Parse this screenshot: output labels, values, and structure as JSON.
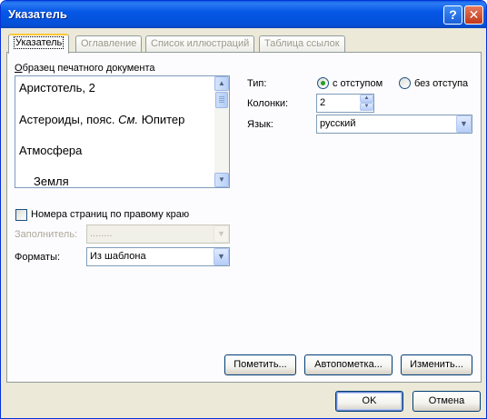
{
  "window": {
    "title": "Указатель",
    "help_button": "?",
    "close_button": "✕"
  },
  "tabs": [
    {
      "label": "Указатель",
      "active": true
    },
    {
      "label": "Оглавление",
      "active": false
    },
    {
      "label": "Список иллюстраций",
      "active": false
    },
    {
      "label": "Таблица ссылок",
      "active": false
    }
  ],
  "preview": {
    "label": "Образец печатного документа",
    "entries": [
      "Аристотель, 2",
      "Астероиды, пояс. См. Юпитер",
      "Атмосфера",
      "Земля"
    ],
    "entry_prefix_see": "Астероиды, пояс.",
    "entry_see_word": "См.",
    "entry_see_target": "Юпитер"
  },
  "type": {
    "label": "Тип:",
    "options": [
      {
        "label": "с отступом",
        "selected": true
      },
      {
        "label": "без отступа",
        "selected": false
      }
    ]
  },
  "columns": {
    "label": "Колонки:",
    "value": "2"
  },
  "language": {
    "label": "Язык:",
    "value": "русский"
  },
  "right_align": {
    "label": "Номера страниц по правому краю",
    "checked": false
  },
  "filler": {
    "label": "Заполнитель:",
    "value": "........"
  },
  "formats": {
    "label": "Форматы:",
    "value": "Из шаблона"
  },
  "buttons": {
    "mark": "Пометить...",
    "automark": "Автопометка...",
    "modify": "Изменить...",
    "ok": "OK",
    "cancel": "Отмена"
  },
  "colors": {
    "titlebar": "#0557e6",
    "dialog_bg": "#ece9d8",
    "radio_dot": "#21a121",
    "active_tab_accent": "#ffc83c"
  },
  "icons": {
    "scroll_up": "▲",
    "scroll_down": "▼",
    "dropdown": "▼",
    "spin_up": "▲",
    "spin_down": "▼"
  }
}
